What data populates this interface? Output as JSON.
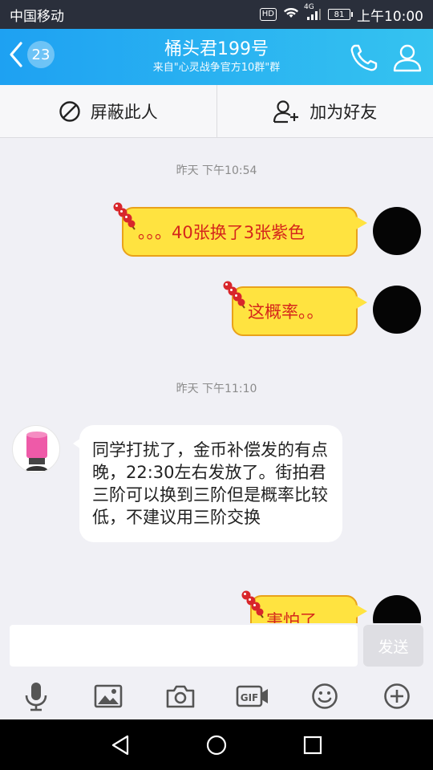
{
  "status": {
    "carrier": "中国移动",
    "hd": "HD",
    "network": "4G",
    "battery": "81",
    "time": "上午10:00"
  },
  "header": {
    "unread_count": "23",
    "title": "桶头君199号",
    "subtitle": "来自\"心灵战争官方10群\"群"
  },
  "actions": {
    "block": "屏蔽此人",
    "add_friend": "加为好友"
  },
  "chat": {
    "timestamps": [
      "昨天 下午10:54",
      "昨天 下午11:10"
    ],
    "messages": [
      {
        "from": "me",
        "text": "。。。40张换了3张紫色"
      },
      {
        "from": "me",
        "text": "这概率。。"
      },
      {
        "from": "other",
        "text": "同学打扰了，金币补偿发的有点晚，22:30左右发放了。街拍君三阶可以换到三阶但是概率比较低，不建议用三阶交换"
      },
      {
        "from": "me",
        "text": "害怕了"
      }
    ]
  },
  "input": {
    "value": "",
    "send_label": "发送"
  },
  "toolbar": {
    "icons": [
      "microphone-icon",
      "image-icon",
      "camera-icon",
      "gif-icon",
      "emoji-icon",
      "plus-icon"
    ]
  },
  "colors": {
    "title_gradient_start": "#1ea1f2",
    "title_gradient_end": "#35c3f0",
    "bubble_fill": "#ffe340",
    "bubble_border": "#e9a21a",
    "bubble_text": "#d5261b"
  }
}
